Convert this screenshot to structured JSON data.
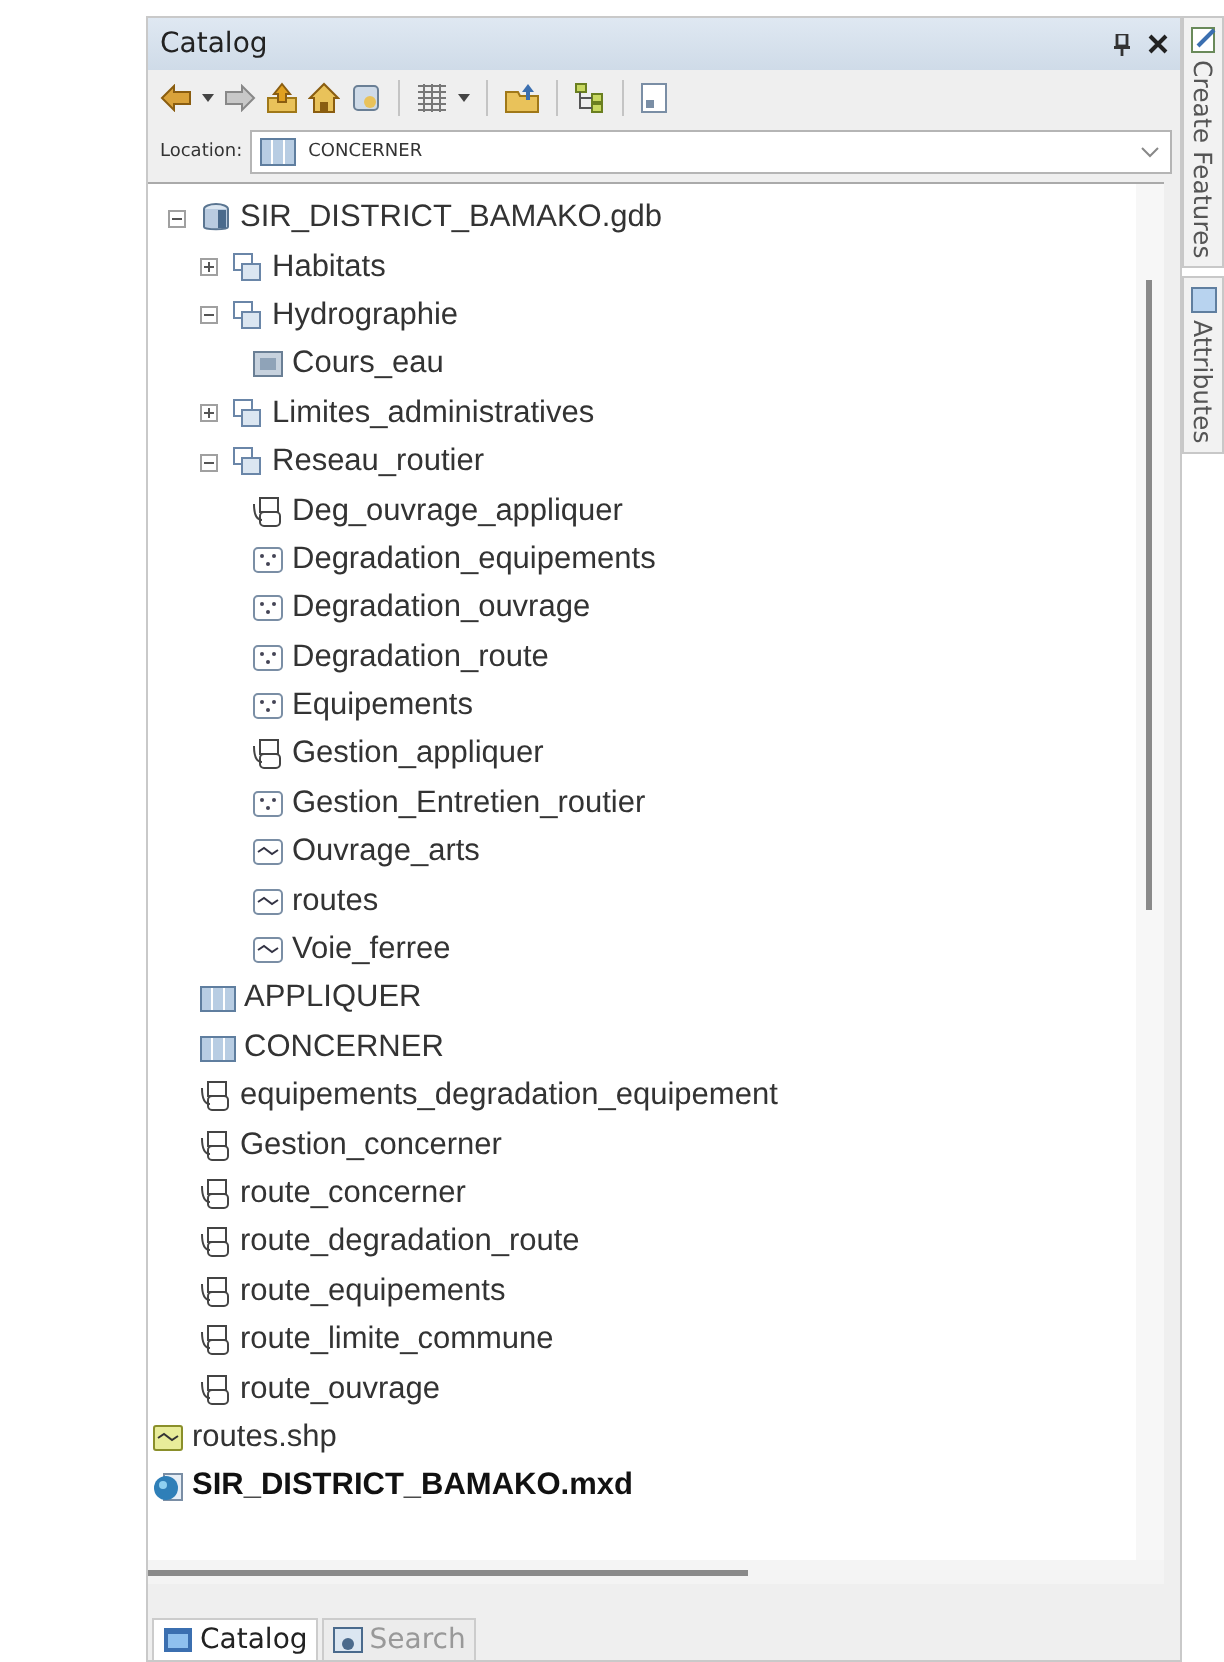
{
  "window": {
    "title": "Catalog"
  },
  "location": {
    "label": "Location:",
    "value": "CONCERNER"
  },
  "tree": [
    {
      "label": "SIR_DISTRICT_BAMAKO.gdb",
      "kind": "gdb",
      "expanded": true,
      "children": [
        {
          "label": "Habitats",
          "kind": "dataset",
          "expanded": false
        },
        {
          "label": "Hydrographie",
          "kind": "dataset",
          "expanded": true,
          "children": [
            {
              "label": "Cours_eau",
              "kind": "raster"
            }
          ]
        },
        {
          "label": "Limites_administratives",
          "kind": "dataset",
          "expanded": false
        },
        {
          "label": "Reseau_routier",
          "kind": "dataset",
          "expanded": true,
          "children": [
            {
              "label": "Deg_ouvrage_appliquer",
              "kind": "relationship"
            },
            {
              "label": "Degradation_equipements",
              "kind": "point"
            },
            {
              "label": "Degradation_ouvrage",
              "kind": "point"
            },
            {
              "label": "Degradation_route",
              "kind": "point"
            },
            {
              "label": "Equipements",
              "kind": "point"
            },
            {
              "label": "Gestion_appliquer",
              "kind": "relationship"
            },
            {
              "label": "Gestion_Entretien_routier",
              "kind": "point"
            },
            {
              "label": "Ouvrage_arts",
              "kind": "line"
            },
            {
              "label": "routes",
              "kind": "line"
            },
            {
              "label": "Voie_ferree",
              "kind": "line"
            }
          ]
        },
        {
          "label": "APPLIQUER",
          "kind": "table"
        },
        {
          "label": "CONCERNER",
          "kind": "table"
        },
        {
          "label": "equipements_degradation_equipement",
          "kind": "relationship"
        },
        {
          "label": "Gestion_concerner",
          "kind": "relationship"
        },
        {
          "label": "route_concerner",
          "kind": "relationship"
        },
        {
          "label": "route_degradation_route",
          "kind": "relationship"
        },
        {
          "label": "route_equipements",
          "kind": "relationship"
        },
        {
          "label": "route_limite_commune",
          "kind": "relationship"
        },
        {
          "label": "route_ouvrage",
          "kind": "relationship"
        }
      ]
    },
    {
      "label": "routes.shp",
      "kind": "shapefile"
    },
    {
      "label": "SIR_DISTRICT_BAMAKO.mxd",
      "kind": "mxd"
    }
  ],
  "bottom_tabs": [
    {
      "label": "Catalog",
      "selected": true
    },
    {
      "label": "Search",
      "selected": false
    }
  ],
  "side_tabs": [
    {
      "label": "Create Features"
    },
    {
      "label": "Attributes"
    }
  ]
}
